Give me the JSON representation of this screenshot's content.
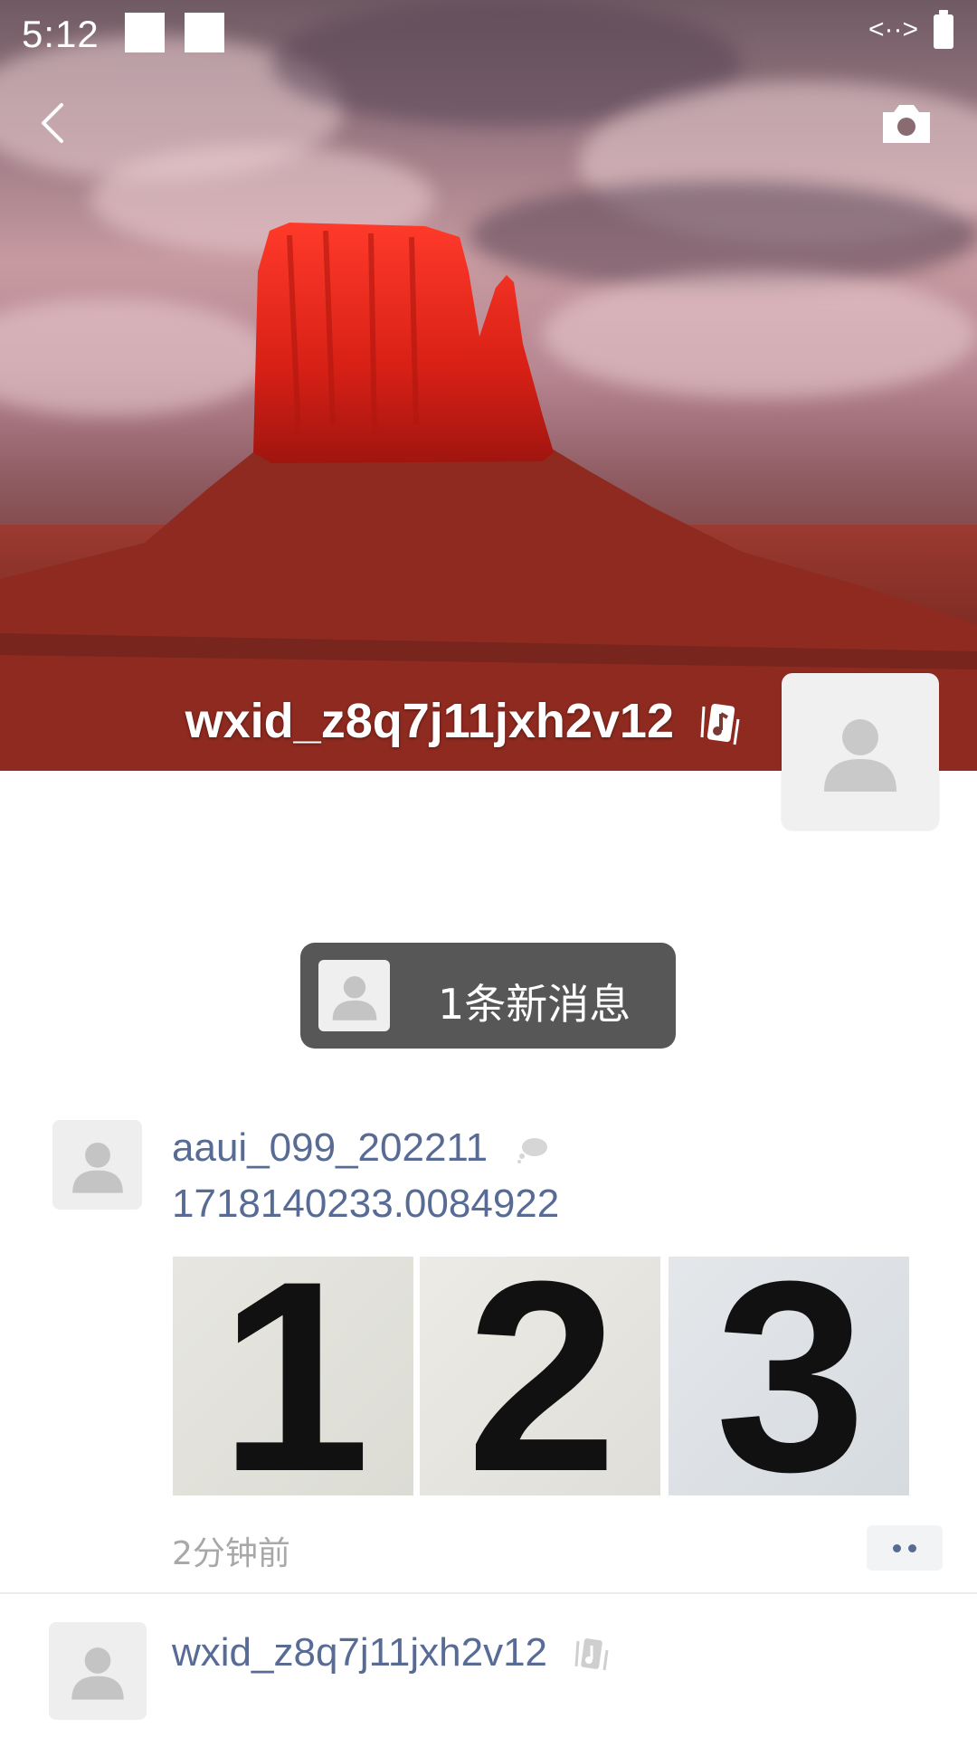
{
  "status_bar": {
    "time": "5:12",
    "data_indicator": "<··>",
    "icons": [
      "notification-square-icon",
      "notification-square-icon",
      "data-transfer-icon",
      "battery-icon"
    ]
  },
  "header": {
    "back_icon": "chevron-left-icon",
    "camera_icon": "camera-icon"
  },
  "profile": {
    "name": "wxid_z8q7j11jxh2v12",
    "name_icon": "music-note-badge-icon",
    "avatar_icon": "default-user-icon"
  },
  "new_message": {
    "label": "1条新消息",
    "avatar_icon": "default-user-icon"
  },
  "posts": [
    {
      "author": "aaui_099_202211",
      "author_icon": "cloud-status-icon",
      "text": "1718140233.0084922",
      "images": [
        "1",
        "2",
        "3"
      ],
      "time": "2分钟前",
      "more_icon": "more-dots-icon"
    },
    {
      "author": "wxid_z8q7j11jxh2v12",
      "author_icon": "music-note-badge-icon"
    }
  ],
  "colors": {
    "link_blue": "#576b95",
    "pill_bg": "#575757",
    "muted": "#a8a8a8"
  }
}
